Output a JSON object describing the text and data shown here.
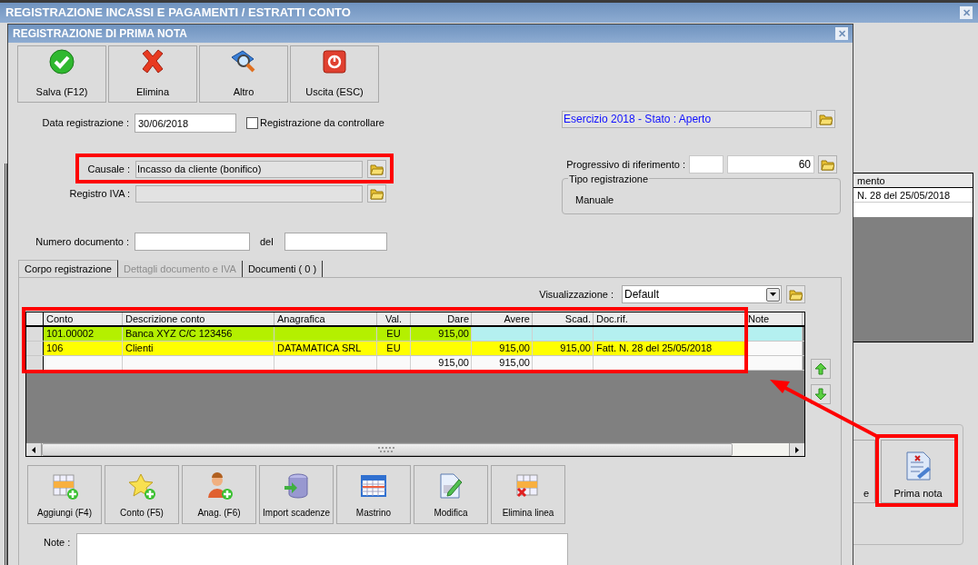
{
  "background_window": {
    "title": "REGISTRAZIONE INCASSI E PAGAMENTI / ESTRATTI CONTO",
    "close": "✕",
    "grid": {
      "column": "mento",
      "rows": [
        "N. 28 del 25/05/2018"
      ]
    },
    "buttons": [
      {
        "label": "e"
      },
      {
        "label": "Prima nota"
      }
    ]
  },
  "dialog": {
    "title": "REGISTRAZIONE DI PRIMA NOTA",
    "close": "✕",
    "toolbar": [
      {
        "label": "Salva (F12)"
      },
      {
        "label": "Elimina"
      },
      {
        "label": "Altro"
      },
      {
        "label": "Uscita (ESC)"
      }
    ],
    "form": {
      "data_registrazione": {
        "label": "Data registrazione :",
        "value": "30/06/2018"
      },
      "da_controllare": {
        "label": "Registrazione da controllare",
        "checked": false
      },
      "causale": {
        "label": "Causale :",
        "value": "Incasso da cliente (bonifico)"
      },
      "registro_iva": {
        "label": "Registro IVA :"
      },
      "numero_documento": {
        "label": "Numero documento :"
      },
      "del": {
        "label": "del"
      },
      "esercizio": {
        "value": "Esercizio 2018 - Stato : Aperto"
      },
      "progressivo": {
        "label": "Progressivo di riferimento :",
        "value": "60"
      },
      "tipo_registrazione": {
        "label": "Tipo registrazione",
        "value": "Manuale"
      }
    },
    "tabs": [
      {
        "label": "Corpo registrazione",
        "selected": true,
        "disabled": false
      },
      {
        "label": "Dettagli documento e IVA",
        "selected": false,
        "disabled": true
      },
      {
        "label": "Documenti ( 0 )",
        "selected": false,
        "disabled": false
      }
    ],
    "visualizzazione": {
      "label": "Visualizzazione :",
      "value": "Default"
    },
    "table": {
      "columns": [
        {
          "label": "Conto"
        },
        {
          "label": "Descrizione conto"
        },
        {
          "label": "Anagrafica"
        },
        {
          "label": "Val."
        },
        {
          "label": "Dare"
        },
        {
          "label": "Avere"
        },
        {
          "label": "Scad."
        },
        {
          "label": "Doc.rif."
        },
        {
          "label": "Note"
        }
      ],
      "rows": [
        {
          "cells": [
            {
              "text": "101.00002",
              "color": "#b4f000"
            },
            {
              "text": "Banca XYZ C/C 123456",
              "color": "#b4f000"
            },
            {
              "color": "#b4f000"
            },
            {
              "text": "EU",
              "color": "#b4f000"
            },
            {
              "text": "915,00",
              "color": "#b4f000"
            },
            {
              "color": "#b4f0f0"
            },
            {
              "color": "#b4f0f0"
            },
            {
              "color": "#b4f0f0"
            },
            {
              "color": "#b4f0f0"
            }
          ]
        },
        {
          "cells": [
            {
              "text": "106",
              "color": "#ffff00"
            },
            {
              "text": "Clienti",
              "color": "#ffff00"
            },
            {
              "text": "DATAMATICA SRL",
              "color": "#ffff00"
            },
            {
              "text": "EU",
              "color": "#ffff00"
            },
            {
              "color": "#ffff00"
            },
            {
              "text": "915,00",
              "color": "#ffff00"
            },
            {
              "text": "915,00",
              "color": "#ffff00"
            },
            {
              "text": "Fatt. N. 28 del 25/05/2018",
              "color": "#ffff00"
            },
            {}
          ]
        },
        {
          "cells": [
            {},
            {},
            {},
            {},
            {
              "text": "915,00"
            },
            {
              "text": "915,00"
            },
            {},
            {},
            {}
          ]
        }
      ]
    },
    "actions": [
      {
        "label": "Aggiungi (F4)"
      },
      {
        "label": "Conto (F5)"
      },
      {
        "label": "Anag. (F6)"
      },
      {
        "label": "Import scadenze"
      },
      {
        "label": "Mastrino"
      },
      {
        "label": "Modifica"
      },
      {
        "label": "Elimina linea"
      }
    ],
    "note": {
      "label": "Note :"
    }
  }
}
